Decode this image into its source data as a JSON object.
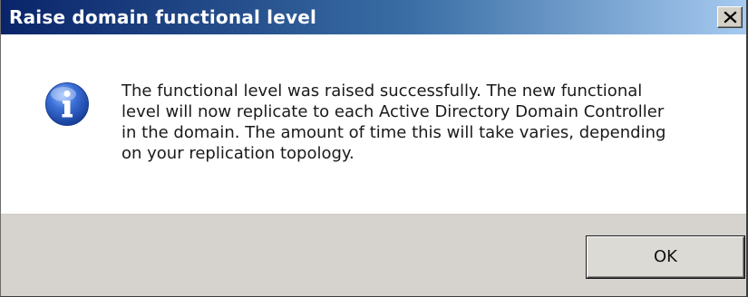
{
  "window": {
    "title": "Raise domain functional level"
  },
  "titlebar": {
    "close_icon": "close-icon"
  },
  "message": {
    "icon": "info-icon",
    "text": "The functional level was raised successfully. The new functional\nlevel will now replicate to each Active Directory Domain Controller\nin the domain. The amount of time this will take varies, depending\non your replication topology."
  },
  "buttons": {
    "ok_label": "OK"
  },
  "colors": {
    "titlebar_start": "#0a246a",
    "titlebar_end": "#a6caf0",
    "footer_bg": "#d6d3ce",
    "icon_blue": "#2d5fc4"
  }
}
